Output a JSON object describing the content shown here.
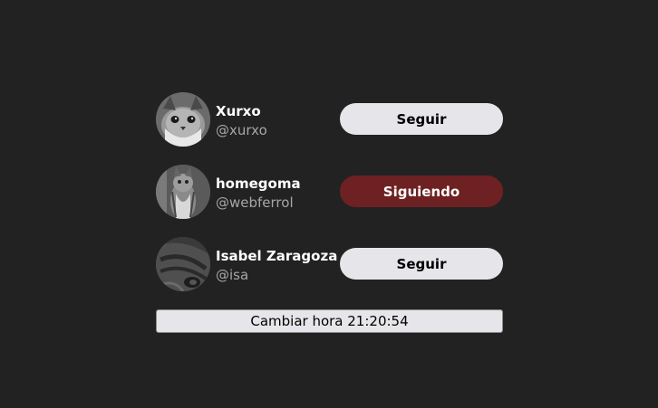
{
  "users": [
    {
      "name": "Xurxo",
      "handle": "@xurxo",
      "button_label": "Seguir",
      "following": false
    },
    {
      "name": "homegoma",
      "handle": "@webferrol",
      "button_label": "Siguiendo",
      "following": true
    },
    {
      "name": "Isabel Zaragoza",
      "handle": "@isa",
      "button_label": "Seguir",
      "following": false
    }
  ],
  "time_button": {
    "label": "Cambiar hora 21:20:54"
  },
  "colors": {
    "background": "#222222",
    "follow_button": "#e6e6ea",
    "following_button": "#6e2122",
    "handle_text": "#a6a6a6"
  }
}
